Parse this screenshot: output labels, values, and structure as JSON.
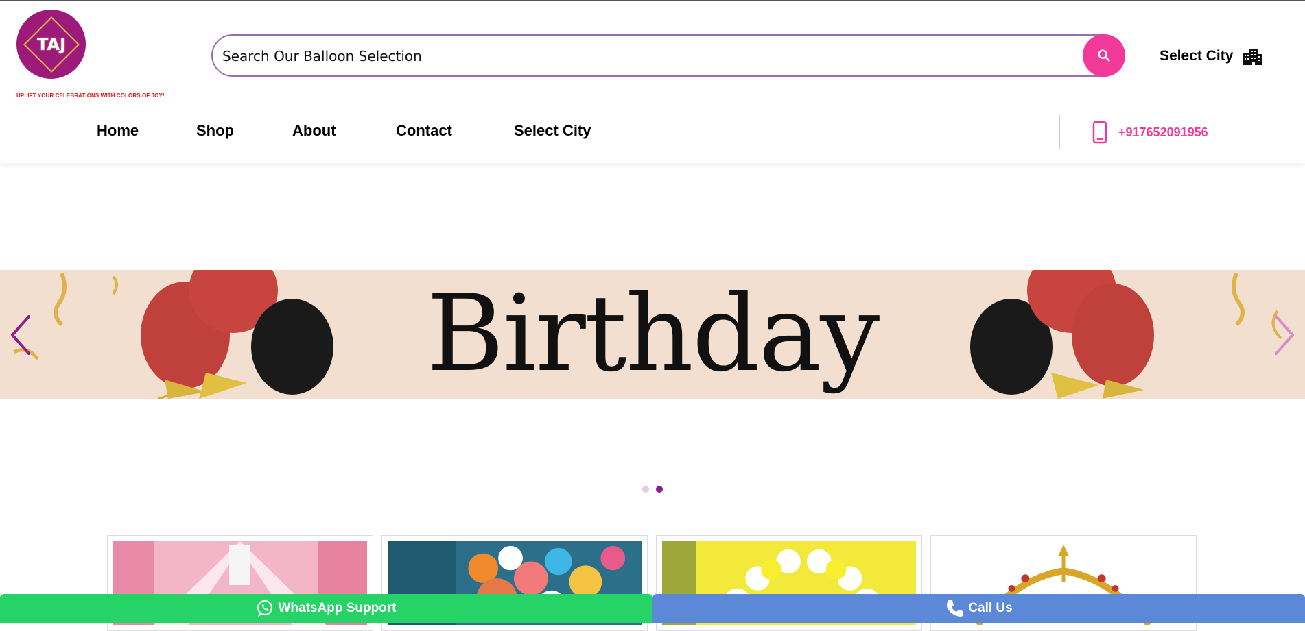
{
  "brand": {
    "logo_text": "TAJ",
    "tagline": "UPLIFT YOUR CELEBRATIONS WITH COLORS OF JOY!"
  },
  "search": {
    "placeholder": "Search Our Balloon Selection",
    "value": ""
  },
  "header": {
    "select_city_label": "Select City"
  },
  "nav": {
    "items": [
      {
        "label": "Home"
      },
      {
        "label": "Shop"
      },
      {
        "label": "About"
      },
      {
        "label": "Contact"
      },
      {
        "label": "Select City"
      }
    ],
    "phone": "+917652091956"
  },
  "banner": {
    "title": "Birthday",
    "active_slide": 2,
    "slide_count": 2
  },
  "cards": [
    {
      "name": "pink-tent-decor"
    },
    {
      "name": "colorful-balloon-ceiling"
    },
    {
      "name": "yellow-white-balloon-arch"
    },
    {
      "name": "golden-decor"
    }
  ],
  "bottom_bar": {
    "whatsapp_label": "WhatsApp Support",
    "call_label": "Call Us"
  },
  "colors": {
    "accent_pink": "#f2399a",
    "brand_purple": "#9e1a7a",
    "whatsapp_green": "#26d366",
    "call_blue": "#5b89d8",
    "banner_bg": "#f3dfcf"
  }
}
